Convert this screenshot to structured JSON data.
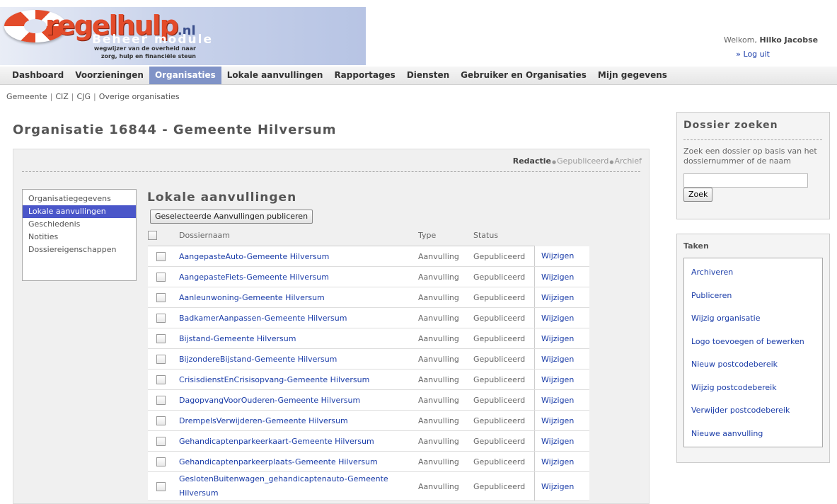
{
  "header": {
    "brand": "regelhulp",
    "brand_suffix": ".nl",
    "module": "Beheer module",
    "tagline_1": "wegwijzer van de overheid naar",
    "tagline_2": "zorg, hulp en financiële steun",
    "welcome_prefix": "Welkom, ",
    "user_name": "Hilko Jacobse",
    "logout": "» Log uit"
  },
  "nav": [
    {
      "label": "Dashboard",
      "active": false
    },
    {
      "label": "Voorzieningen",
      "active": false
    },
    {
      "label": "Organisaties",
      "active": true
    },
    {
      "label": "Lokale aanvullingen",
      "active": false
    },
    {
      "label": "Rapportages",
      "active": false
    },
    {
      "label": "Diensten",
      "active": false
    },
    {
      "label": "Gebruiker en Organisaties",
      "active": false
    },
    {
      "label": "Mijn gegevens",
      "active": false
    }
  ],
  "subnav": [
    "Gemeente",
    "CIZ",
    "CJG",
    "Overige organisaties"
  ],
  "page_title": "Organisatie 16844 - Gemeente Hilversum",
  "status": {
    "current": "Redactie",
    "published": "Gepubliceerd",
    "archive": "Archief"
  },
  "side_menu": [
    {
      "label": "Organisatiegegevens",
      "active": false
    },
    {
      "label": "Lokale aanvullingen",
      "active": true
    },
    {
      "label": "Geschiedenis",
      "active": false
    },
    {
      "label": "Notities",
      "active": false
    },
    {
      "label": "Dossiereigenschappen",
      "active": false
    }
  ],
  "section_title": "Lokale aanvullingen",
  "publish_button": "Geselecteerde Aanvullingen publiceren",
  "table": {
    "headers": {
      "name": "Dossiernaam",
      "type": "Type",
      "status": "Status"
    },
    "rows": [
      {
        "name": "AangepasteAuto-Gemeente Hilversum",
        "type": "Aanvulling",
        "status": "Gepubliceerd",
        "action": "Wijzigen"
      },
      {
        "name": "AangepasteFiets-Gemeente Hilversum",
        "type": "Aanvulling",
        "status": "Gepubliceerd",
        "action": "Wijzigen"
      },
      {
        "name": "Aanleunwoning-Gemeente Hilversum",
        "type": "Aanvulling",
        "status": "Gepubliceerd",
        "action": "Wijzigen"
      },
      {
        "name": "BadkamerAanpassen-Gemeente Hilversum",
        "type": "Aanvulling",
        "status": "Gepubliceerd",
        "action": "Wijzigen"
      },
      {
        "name": "Bijstand-Gemeente Hilversum",
        "type": "Aanvulling",
        "status": "Gepubliceerd",
        "action": "Wijzigen"
      },
      {
        "name": "BijzondereBijstand-Gemeente Hilversum",
        "type": "Aanvulling",
        "status": "Gepubliceerd",
        "action": "Wijzigen"
      },
      {
        "name": "CrisisdienstEnCrisisopvang-Gemeente Hilversum",
        "type": "Aanvulling",
        "status": "Gepubliceerd",
        "action": "Wijzigen"
      },
      {
        "name": "DagopvangVoorOuderen-Gemeente Hilversum",
        "type": "Aanvulling",
        "status": "Gepubliceerd",
        "action": "Wijzigen"
      },
      {
        "name": "DrempelsVerwijderen-Gemeente Hilversum",
        "type": "Aanvulling",
        "status": "Gepubliceerd",
        "action": "Wijzigen"
      },
      {
        "name": "Gehandicaptenparkeerkaart-Gemeente Hilversum",
        "type": "Aanvulling",
        "status": "Gepubliceerd",
        "action": "Wijzigen"
      },
      {
        "name": "Gehandicaptenparkeerplaats-Gemeente Hilversum",
        "type": "Aanvulling",
        "status": "Gepubliceerd",
        "action": "Wijzigen"
      },
      {
        "name": "GeslotenBuitenwagen_gehandicaptenauto-Gemeente Hilversum",
        "type": "Aanvulling",
        "status": "Gepubliceerd",
        "action": "Wijzigen"
      }
    ]
  },
  "search": {
    "title": "Dossier zoeken",
    "help": "Zoek een dossier op basis van het dossiernummer of de naam",
    "input_value": "",
    "button": "Zoek"
  },
  "tasks": {
    "title": "Taken",
    "items": [
      "Archiveren",
      "Publiceren",
      "Wijzig organisatie",
      "Logo toevoegen of bewerken",
      "Nieuw postcodebereik",
      "Wijzig postcodebereik",
      "Verwijder postcodebereik",
      "Nieuwe aanvulling"
    ]
  }
}
